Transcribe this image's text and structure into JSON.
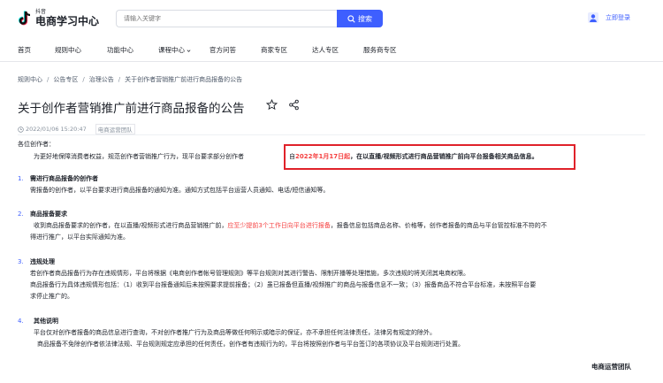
{
  "header": {
    "logo_small": "抖音",
    "logo_title": "电商学习中心",
    "search_placeholder": "请输入关键字",
    "search_button": "搜索",
    "login_text": "立即登录"
  },
  "nav": {
    "items": [
      {
        "label": "首页",
        "dropdown": false
      },
      {
        "label": "规则中心",
        "dropdown": false
      },
      {
        "label": "功能中心",
        "dropdown": false
      },
      {
        "label": "课程中心",
        "dropdown": true
      },
      {
        "label": "官方问答",
        "dropdown": false
      },
      {
        "label": "商家专区",
        "dropdown": false
      },
      {
        "label": "达人专区",
        "dropdown": false
      },
      {
        "label": "服务商专区",
        "dropdown": false
      }
    ]
  },
  "breadcrumb": [
    "规则中心",
    "公告专区",
    "治理公告",
    "关于创作者营销推广前进行商品报备的公告"
  ],
  "article": {
    "title": "关于创作者营销推广前进行商品报备的公告",
    "date": "2022/01/06 15:20:47",
    "team_tag": "电商运营团队",
    "greeting": "各位创作者：",
    "intro_plain": "为更好地保障消费者权益，规范创作者营销推广行为，现平台要求部分创作者",
    "intro_prefix": "自",
    "intro_date": "2022年1月17日起",
    "intro_bold": "，在以直播/视频形式进行商品营销推广前向平台报备相关商品信息。",
    "sections": [
      {
        "num": "1.",
        "heading": "需进行商品报备的创作者",
        "lines": [
          "需报备的创作者，以平台要求进行商品报备的通知为准。通知方式包括平台运营人员通知、电话/短信通知等。"
        ]
      },
      {
        "num": "2.",
        "heading": "商品报备要求",
        "line1_a": "收到商品报备要求的创作者，在以直播/视频形式进行商品营销推广前，",
        "line1_red": "应至少提前3个工作日向平台进行报备",
        "line1_b": "，报备信息包括商品名称、价格等，创作者报备的商品与平台管控标准不符的不",
        "line2": "得进行推广，以平台实际通知为准。"
      },
      {
        "num": "3.",
        "heading": "违规处理",
        "lines": [
          "若创作者商品报备行为存在违规情形，平台将根据《电商创作者帐号管理规则》等平台规则对其进行警告、限制开播等处理措施，多次违规的将关闭其电商权限。",
          "商品报备行为具体违规情形包括：（1）收到平台报备通知后未按照要求提前报备；（2）虽已报备但直播/视频推广的商品与报备信息不一致；（3）报备商品不符合平台标准，未按照平台要",
          "求停止推广的。"
        ]
      },
      {
        "num": "4.",
        "heading": "其他说明",
        "lines": [
          "平台仅对创作者报备的商品信息进行查询，不对创作者推广行为及商品等做任何明示或暗示的保证，亦不承担任何法律责任，法律另有规定的除外。",
          "商品报备不免除创作者依法律法规、平台规则规定应承担的任何责任，创作者有违规行为的，平台将按照创作者与平台签订的各项协议及平台规则进行处置。"
        ]
      }
    ],
    "signature": "电商运营团队"
  },
  "colors": {
    "accent": "#3e5fff",
    "highlight_red": "#e0222a",
    "text_red": "#f53f3f"
  },
  "icons": [
    "douyin-logo-icon",
    "search-icon",
    "user-avatar-icon",
    "chevron-down-icon",
    "star-icon",
    "share-icon",
    "clock-icon"
  ]
}
